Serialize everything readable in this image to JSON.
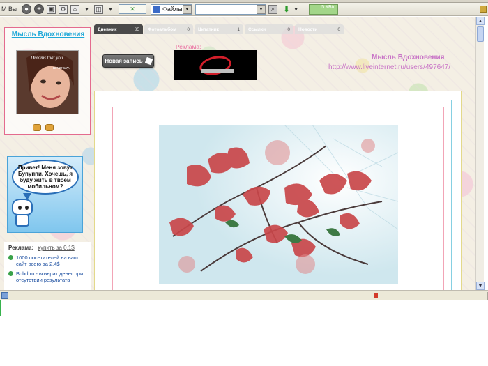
{
  "toolbar": {
    "label": "M Bar",
    "files_label": "Файлы",
    "kb_label": "5 КБ/с"
  },
  "sidebar": {
    "blog_name": "Мысль Вдохновения",
    "mascot_text": "Привет! Меня зовут Бупуппи. Хочешь, я буду жить в твоем мобильном?",
    "ads_title": "Реклама:",
    "ads_buy": "купить за 0.1$",
    "ads_items": [
      {
        "text": "1000 посетителей на ваш сайт всего за 2.4$"
      },
      {
        "text": "Bdbd.ru - возврат денег при отсутствии результата"
      }
    ]
  },
  "tabs": [
    {
      "label": "Дневник",
      "count": "35"
    },
    {
      "label": "Фотоальбом",
      "count": "0"
    },
    {
      "label": "Цитатник",
      "count": "1"
    },
    {
      "label": "Ссылки",
      "count": "0"
    },
    {
      "label": "Новости",
      "count": "0"
    }
  ],
  "header": {
    "new_post": "Новая запись",
    "ad_label": "Реклама:",
    "site_title": "Мысль Вдохновения",
    "site_url": "http://www.liveinternet.ru/users/497647/"
  },
  "colors": {
    "accent_pink": "#e46b8e",
    "link_blue": "#1fa8d8",
    "title_purple": "#c873c6"
  }
}
